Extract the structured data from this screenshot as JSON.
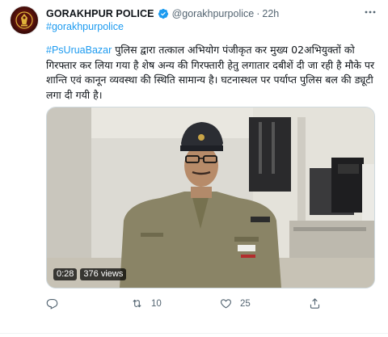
{
  "tweet": {
    "author_name": "GORAKHPUR POLICE",
    "author_handle": "@gorakhpurpolice",
    "separator": "·",
    "time": "22h",
    "top_hashtag": "#gorakhpurpolice",
    "body_hashtag": "#PsUruaBazar",
    "body_text": " पुलिस द्वारा तत्काल अभियोग पंजीकृत कर मुख्य 02अभियुक्तों को गिरफ्तार कर लिया गया है शेष अन्य की गिरफ्तारी हेतु लगातार दबीशें दी जा रही है मौके पर शान्ति एवं कानून व्यवस्था की स्थिति सामान्य है। घटनास्थल पर पर्याप्त पुलिस बल की ड्यूटी लगा दी गयी है।",
    "media": {
      "duration": "0:28",
      "views": "376 views"
    },
    "actions": {
      "reply_count": "",
      "retweet_count": "10",
      "like_count": "25"
    }
  },
  "colors": {
    "link": "#1d9bf0",
    "muted": "#536471",
    "text": "#0f1419"
  }
}
